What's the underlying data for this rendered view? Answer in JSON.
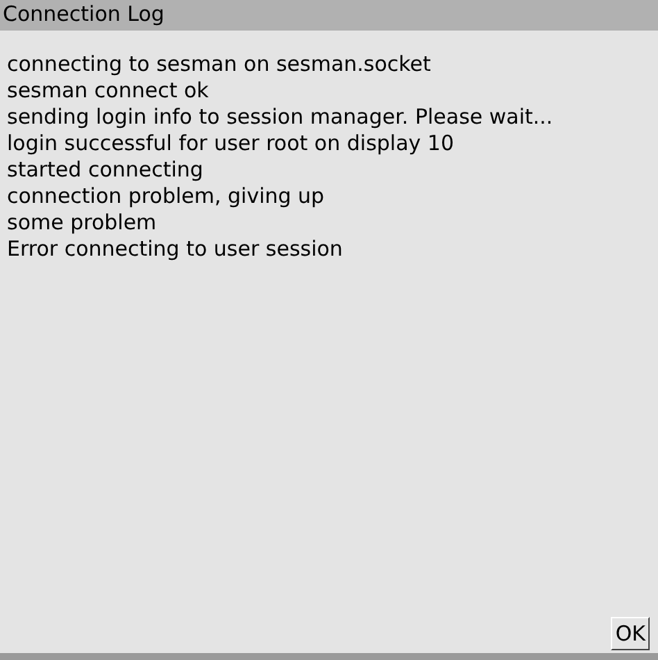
{
  "window": {
    "title": "Connection Log"
  },
  "log_lines": [
    "connecting to sesman on sesman.socket",
    "sesman connect ok",
    "sending login info to session manager. Please wait...",
    "login successful for user root on display 10",
    "started connecting",
    "connection problem, giving up",
    "some problem",
    "Error connecting to user session"
  ],
  "buttons": [
    "OK"
  ]
}
